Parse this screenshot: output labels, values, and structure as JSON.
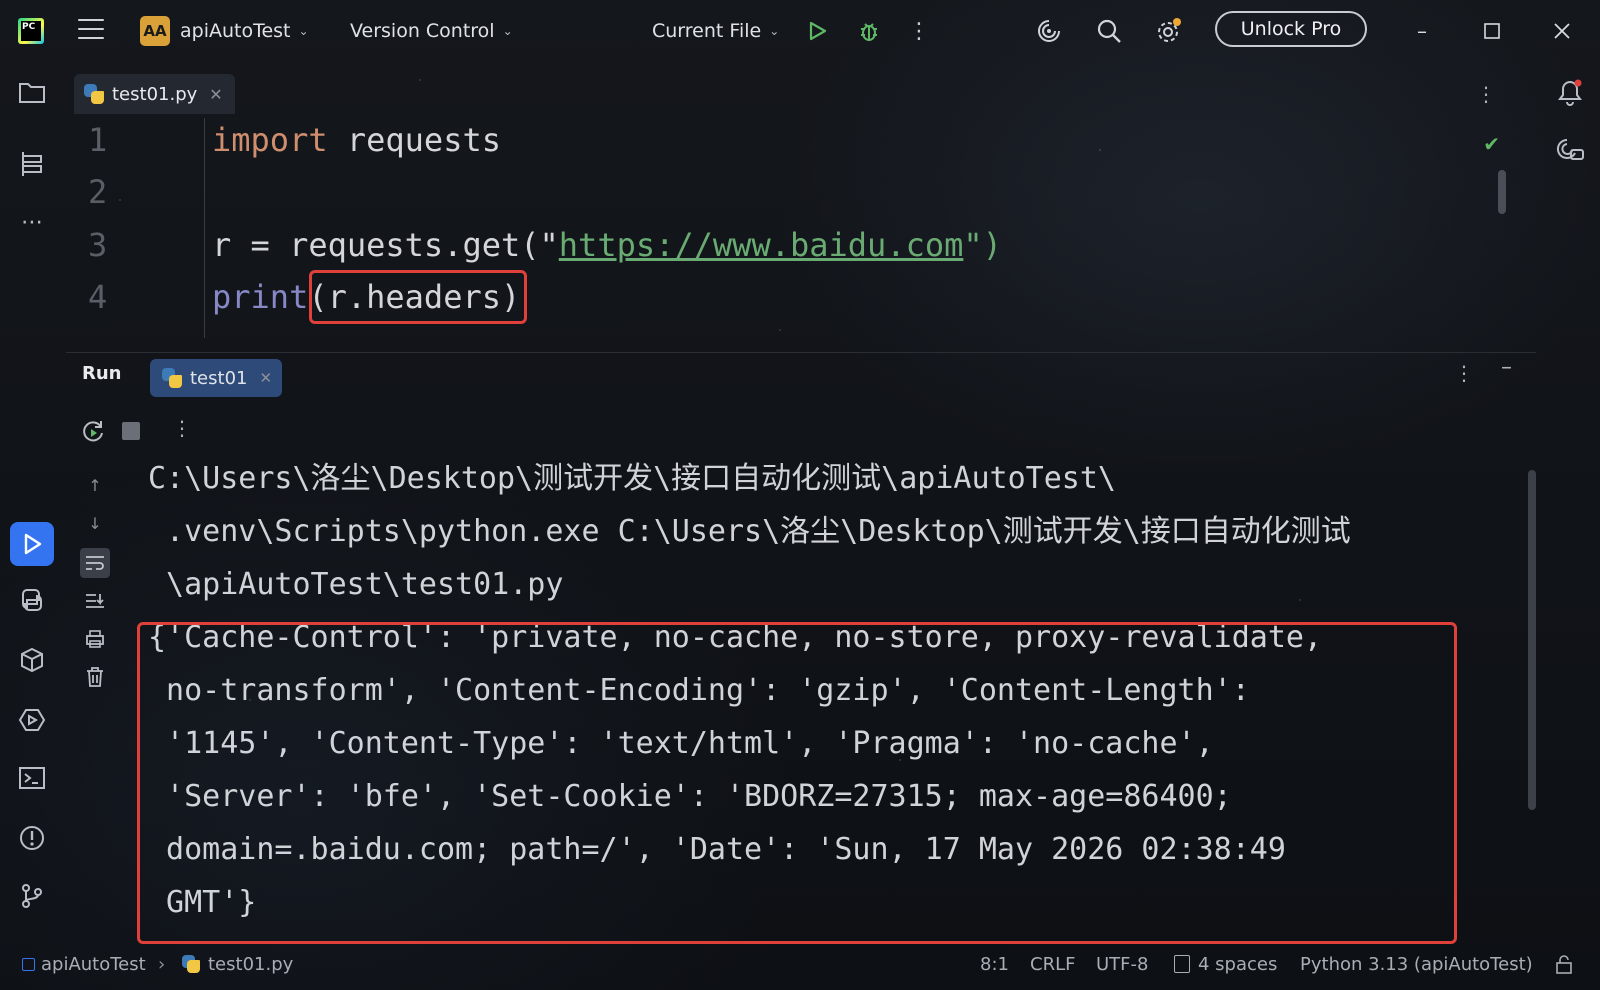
{
  "titlebar": {
    "project_badge": "AA",
    "project_name": "apiAutoTest",
    "vcs_label": "Version Control",
    "run_config": "Current File",
    "unlock_label": "Unlock Pro"
  },
  "editor": {
    "tab_label": "test01.py",
    "lines": [
      {
        "num": "1"
      },
      {
        "num": "2"
      },
      {
        "num": "3"
      },
      {
        "num": "4"
      }
    ],
    "code": {
      "l1_kw": "import",
      "l1_rest": " requests",
      "l3_pre": "r = requests.get(\"",
      "l3_url": "https://www.baidu.com",
      "l3_post": "\")",
      "l4_fn": "print",
      "l4_rest": "(r.headers)"
    }
  },
  "run_panel": {
    "label": "Run",
    "tab_label": "test01",
    "output": [
      "C:\\Users\\洛尘\\Desktop\\测试开发\\接口自动化测试\\apiAutoTest\\",
      " .venv\\Scripts\\python.exe C:\\Users\\洛尘\\Desktop\\测试开发\\接口自动化测试",
      " \\apiAutoTest\\test01.py",
      "{'Cache-Control': 'private, no-cache, no-store, proxy-revalidate,",
      " no-transform', 'Content-Encoding': 'gzip', 'Content-Length':",
      " '1145', 'Content-Type': 'text/html', 'Pragma': 'no-cache',",
      " 'Server': 'bfe', 'Set-Cookie': 'BDORZ=27315; max-age=86400;",
      " domain=.baidu.com; path=/', 'Date': 'Sun, 17 May 2026 02:38:49",
      " GMT'}"
    ]
  },
  "statusbar": {
    "project": "apiAutoTest",
    "file": "test01.py",
    "position": "8:1",
    "line_sep": "CRLF",
    "encoding": "UTF-8",
    "indent": "4 spaces",
    "interpreter": "Python 3.13 (apiAutoTest)"
  },
  "colors": {
    "accent": "#3574f0",
    "highlight_box": "#e0403a",
    "keyword": "#cf8e6d",
    "string": "#6aab73",
    "builtin": "#8888c6"
  },
  "icons": [
    "pycharm-logo",
    "hamburger-menu-icon",
    "run-icon",
    "debug-icon",
    "more-icon",
    "ai-assistant-icon",
    "search-icon",
    "settings-icon",
    "minimize-icon",
    "maximize-icon",
    "close-icon",
    "folder-icon",
    "structure-icon",
    "notifications-icon"
  ]
}
